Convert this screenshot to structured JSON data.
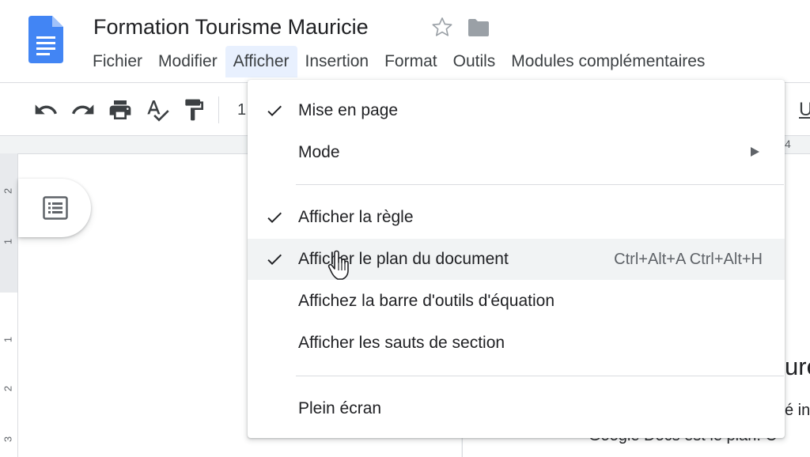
{
  "document": {
    "title": "Formation Tourisme Mauricie"
  },
  "menubar": [
    "Fichier",
    "Modifier",
    "Afficher",
    "Insertion",
    "Format",
    "Outils",
    "Modules complémentaires"
  ],
  "toolbar": {
    "zoom_partial": "1",
    "underline_partial": "U"
  },
  "ruler": {
    "h_number": "4",
    "v_numbers": [
      "2",
      "1",
      "1",
      "2",
      "3"
    ]
  },
  "page": {
    "heading_partial": "ure",
    "text_line1_partial": "é in",
    "text_line2_partial": "Google Docs est le plan. C"
  },
  "dropdown": {
    "items": [
      {
        "label": "Mise en page",
        "checked": true
      },
      {
        "label": "Mode",
        "submenu": true
      },
      {
        "label": "Afficher la règle",
        "checked": true
      },
      {
        "label": "Afficher le plan du document",
        "checked": true,
        "shortcut": "Ctrl+Alt+A Ctrl+Alt+H",
        "hover": true
      },
      {
        "label": "Affichez la barre d'outils d'équation"
      },
      {
        "label": "Afficher les sauts de section"
      },
      {
        "label": "Plein écran"
      }
    ]
  },
  "colors": {
    "docs_blue": "#4285f4",
    "active_menu_bg": "#e8f0fe",
    "hover_bg": "#f1f3f4"
  },
  "icons": [
    "docs-logo-icon",
    "star-icon",
    "folder-icon",
    "undo-icon",
    "redo-icon",
    "print-icon",
    "spellcheck-icon",
    "paint-format-icon",
    "document-outline-icon",
    "checkmark-icon",
    "submenu-arrow-icon",
    "hand-cursor-icon"
  ]
}
